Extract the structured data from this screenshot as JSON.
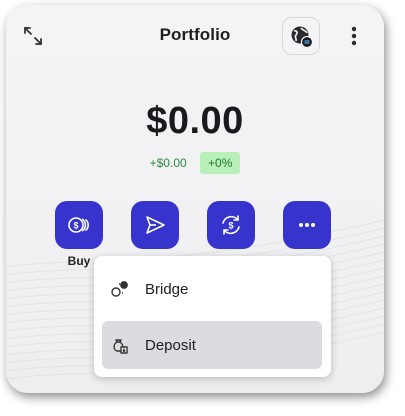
{
  "header": {
    "title": "Portfolio"
  },
  "balance": {
    "amount": "$0.00",
    "change_abs": "+$0.00",
    "change_pct": "+0%"
  },
  "actions": [
    {
      "label": "Buy",
      "icon": "cash-icon"
    },
    {
      "label": "",
      "icon": "send-icon"
    },
    {
      "label": "",
      "icon": "swap-icon"
    },
    {
      "label": "",
      "icon": "more-horizontal-icon"
    }
  ],
  "menu": {
    "items": [
      {
        "label": "Bridge",
        "icon": "bridge-icon"
      },
      {
        "label": "Deposit",
        "icon": "deposit-icon",
        "highlighted": true
      }
    ]
  },
  "colors": {
    "accent": "#3634cc",
    "positive": "#2e8a3e",
    "positive_bg": "#b9efb9"
  }
}
